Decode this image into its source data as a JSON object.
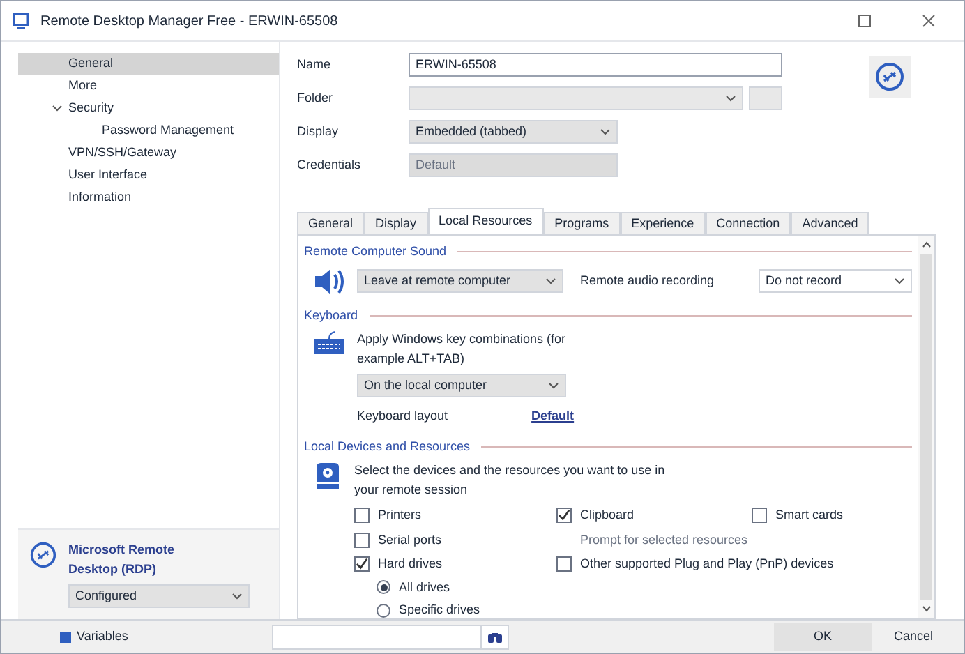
{
  "window": {
    "title": "Remote Desktop Manager Free - ERWIN-65508"
  },
  "sidebar": {
    "items": [
      {
        "label": "General",
        "selected": true
      },
      {
        "label": "More",
        "selected": false
      },
      {
        "label": "Security",
        "selected": false,
        "expanded": true,
        "children": [
          {
            "label": "Password Management",
            "selected": false
          }
        ]
      },
      {
        "label": "VPN/SSH/Gateway",
        "selected": false
      },
      {
        "label": "User Interface",
        "selected": false
      },
      {
        "label": "Information",
        "selected": false
      }
    ]
  },
  "connection_type": {
    "name": "Microsoft Remote Desktop (RDP)",
    "status": "Configured"
  },
  "form": {
    "name_label": "Name",
    "name_value": "ERWIN-65508",
    "folder_label": "Folder",
    "display_label": "Display",
    "display_value": "Embedded (tabbed)",
    "credentials_label": "Credentials",
    "credentials_value": "Default"
  },
  "tabs": [
    {
      "label": "General",
      "selected": false
    },
    {
      "label": "Display",
      "selected": false
    },
    {
      "label": "Local Resources",
      "selected": true
    },
    {
      "label": "Programs",
      "selected": false
    },
    {
      "label": "Experience",
      "selected": false
    },
    {
      "label": "Connection",
      "selected": false
    },
    {
      "label": "Advanced",
      "selected": false
    }
  ],
  "sound": {
    "title": "Remote Computer Sound",
    "playback": "Leave at remote computer",
    "recording_label": "Remote audio recording",
    "recording": "Do not record"
  },
  "keyboard": {
    "title": "Keyboard",
    "description": "Apply Windows key combinations (for example ALT+TAB)",
    "combinations": "On the local computer",
    "layout_label": "Keyboard layout",
    "layout_link": "Default"
  },
  "devices": {
    "title": "Local Devices and Resources",
    "description": "Select the devices and the resources you want to use in your remote session",
    "options": [
      {
        "label": "Printers",
        "checked": false
      },
      {
        "label": "Clipboard",
        "checked": true
      },
      {
        "label": "Smart cards",
        "checked": false
      },
      {
        "label": "Serial ports",
        "checked": false
      }
    ],
    "prompt": "Prompt for selected resources",
    "hard_drives": {
      "label": "Hard drives",
      "checked": true
    },
    "pnp": {
      "label": "Other supported Plug and Play (PnP) devices",
      "checked": false
    },
    "drives": [
      {
        "label": "All drives",
        "selected": true
      },
      {
        "label": "Specific drives",
        "selected": false
      }
    ]
  },
  "footer": {
    "variables": "Variables",
    "ok": "OK",
    "cancel": "Cancel"
  }
}
